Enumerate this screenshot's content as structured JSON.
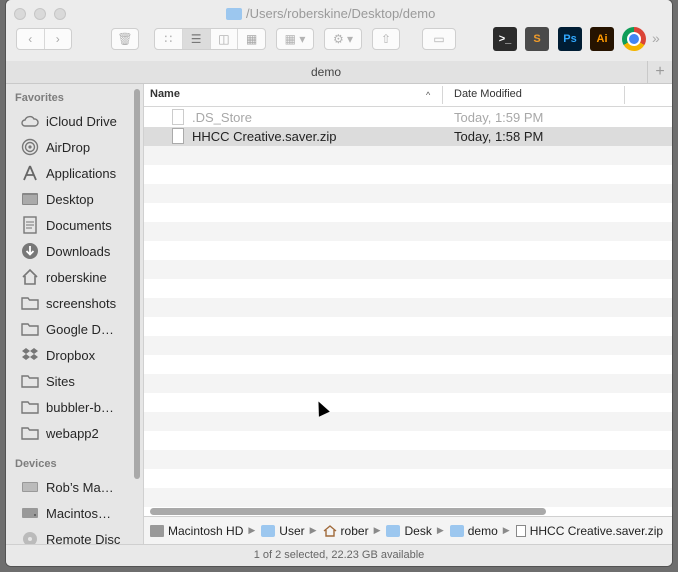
{
  "window": {
    "title": "/Users/roberskine/Desktop/demo"
  },
  "toolbar": {
    "apps": [
      {
        "name": "terminal",
        "label": ">_"
      },
      {
        "name": "sublime-text",
        "label": "S"
      },
      {
        "name": "photoshop",
        "label": "Ps"
      },
      {
        "name": "illustrator",
        "label": "Ai"
      },
      {
        "name": "chrome",
        "label": ""
      }
    ],
    "overflow": "»"
  },
  "tab": {
    "label": "demo",
    "add": "+"
  },
  "sidebar": {
    "favorites_header": "Favorites",
    "favorites": [
      {
        "label": "iCloud Drive",
        "icon": "cloud-icon"
      },
      {
        "label": "AirDrop",
        "icon": "airdrop-icon"
      },
      {
        "label": "Applications",
        "icon": "applications-icon"
      },
      {
        "label": "Desktop",
        "icon": "desktop-icon"
      },
      {
        "label": "Documents",
        "icon": "documents-icon"
      },
      {
        "label": "Downloads",
        "icon": "downloads-icon"
      },
      {
        "label": "roberskine",
        "icon": "home-icon"
      },
      {
        "label": "screenshots",
        "icon": "folder-icon"
      },
      {
        "label": "Google D…",
        "icon": "folder-icon"
      },
      {
        "label": "Dropbox",
        "icon": "dropbox-icon"
      },
      {
        "label": "Sites",
        "icon": "folder-icon"
      },
      {
        "label": "bubbler-b…",
        "icon": "folder-icon"
      },
      {
        "label": "webapp2",
        "icon": "folder-icon"
      }
    ],
    "devices_header": "Devices",
    "devices": [
      {
        "label": "Rob’s Ma…",
        "icon": "computer-icon"
      },
      {
        "label": "Macintos…",
        "icon": "disk-icon"
      },
      {
        "label": "Remote Disc",
        "icon": "disc-icon"
      }
    ]
  },
  "list": {
    "col_name": "Name",
    "col_date": "Date Modified",
    "sort_indicator": "^",
    "files": [
      {
        "name": ".DS_Store",
        "date": "Today, 1:59 PM",
        "hidden": true,
        "selected": false
      },
      {
        "name": "HHCC Creative.saver.zip",
        "date": "Today, 1:58 PM",
        "hidden": false,
        "selected": true
      }
    ]
  },
  "pathbar": {
    "crumbs": [
      "Macintosh HD",
      "User",
      "rober",
      "Desk",
      "demo",
      "HHCC Creative.saver.zip"
    ]
  },
  "status": {
    "text": "1 of 2 selected, 22.23 GB available"
  },
  "colors": {
    "folder_blue": "#9cc7ef",
    "selection": "#dcdcdc"
  }
}
